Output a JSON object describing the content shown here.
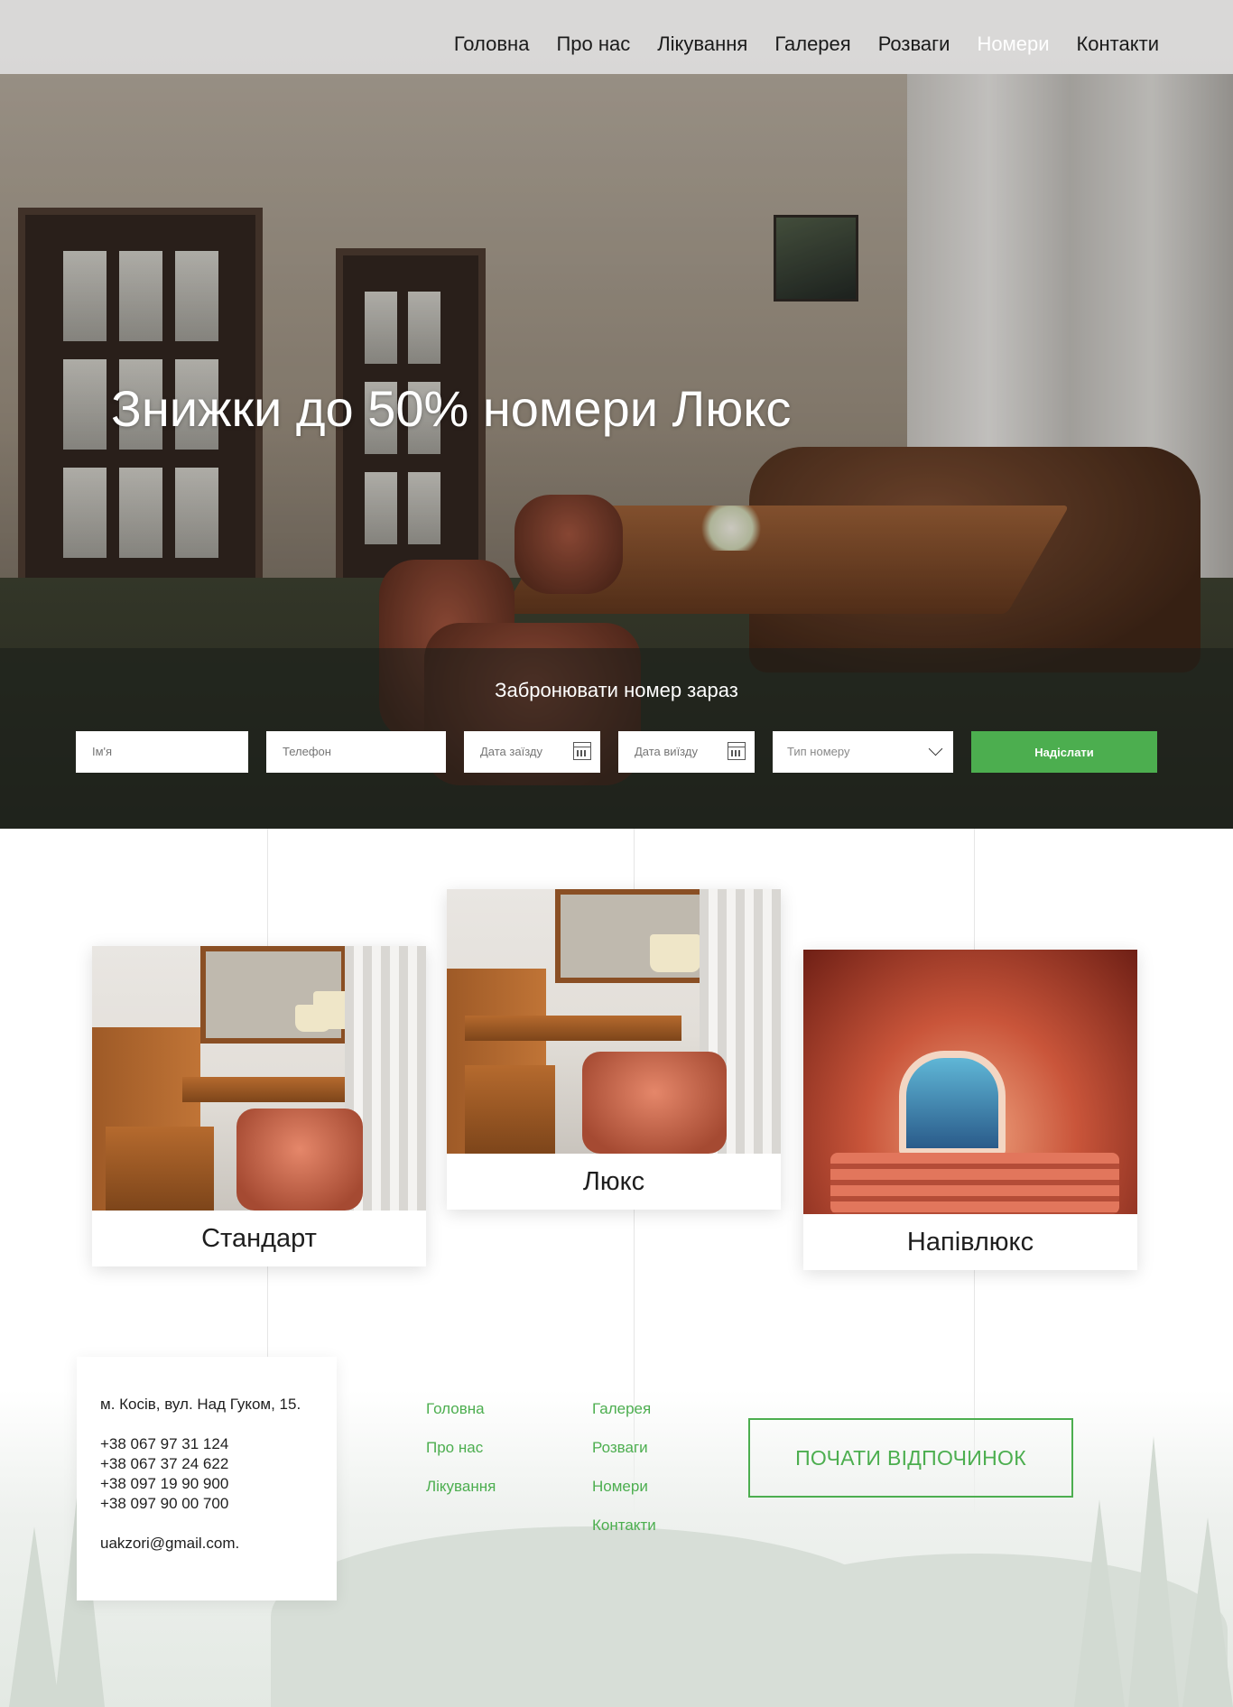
{
  "nav": {
    "items": [
      {
        "label": "Головна"
      },
      {
        "label": "Про нас"
      },
      {
        "label": "Лікування"
      },
      {
        "label": "Галерея"
      },
      {
        "label": "Розваги"
      },
      {
        "label": "Номери"
      },
      {
        "label": "Контакти"
      }
    ],
    "active": "Номери"
  },
  "hero": {
    "title": "Знижки до 50% номери Люкс"
  },
  "booking": {
    "title": "Забронювати номер зараз",
    "name_placeholder": "Ім'я",
    "phone_placeholder": "Телефон",
    "checkin_placeholder": "Дата заїзду",
    "checkout_placeholder": "Дата виїзду",
    "room_type_placeholder": "Тип номеру",
    "submit_label": "Надіслати"
  },
  "rooms": [
    {
      "label": "Стандарт"
    },
    {
      "label": "Люкс"
    },
    {
      "label": "Напівлюкс"
    }
  ],
  "contact": {
    "address": "м. Косів, вул. Над Гуком, 15.",
    "phones": [
      "+38 067 97 31 124",
      "+38 067 37 24 622",
      "+38 097 19 90 900",
      "+38 097 90 00 700"
    ],
    "email": "uakzori@gmail.com."
  },
  "footer_nav": {
    "col1": [
      "Головна",
      "Про нас",
      "Лікування"
    ],
    "col2": [
      "Галерея",
      "Розваги",
      "Номери",
      "Контакти"
    ]
  },
  "cta_label": "ПОЧАТИ ВІДПОЧИНОК",
  "colors": {
    "accent": "#4cae4f",
    "nav_bg": "#ebebeb",
    "text": "#1e1e1e"
  }
}
